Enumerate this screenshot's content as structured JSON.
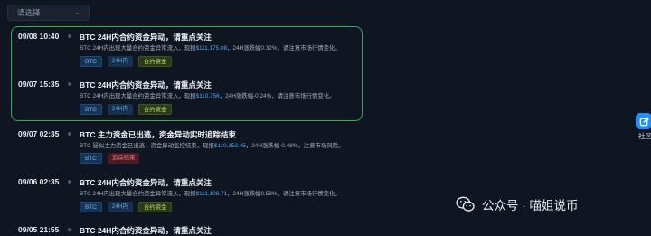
{
  "filter": {
    "placeholder": "请选择"
  },
  "feed": {
    "items": [
      {
        "time": "09/08 10:40",
        "title": "BTC 24H内合约资金异动，请重点关注",
        "desc_pre": "BTC 24H内出现大量合约资金异常流入，现报",
        "price": "$111,175.08",
        "desc_post": "，24H涨跌幅0.32%，请注意市场行情变化。",
        "tags": [
          {
            "label": "BTC",
            "kind": "coin"
          },
          {
            "label": "24H内",
            "kind": "period"
          },
          {
            "label": "合约资金",
            "kind": "contract"
          }
        ]
      },
      {
        "time": "09/07 15:35",
        "title": "BTC 24H内合约资金异动，请重点关注",
        "desc_pre": "BTC 24H内出现大量合约资金异常流入，现报",
        "price": "$110,756",
        "desc_post": "，24H涨跌幅-0.24%，请注意市场行情变化。",
        "tags": [
          {
            "label": "BTC",
            "kind": "coin"
          },
          {
            "label": "24H内",
            "kind": "period"
          },
          {
            "label": "合约资金",
            "kind": "contract"
          }
        ]
      },
      {
        "time": "09/07 02:35",
        "title": "BTC 主力资金已出逃，资金异动实时追踪结束",
        "desc_pre": "BTC 疑似主力资金已出逃，资金异动监控结束，现报",
        "price": "$110,152.45",
        "desc_post": "，24H涨跌幅-0.48%，注意市场风险。",
        "tags": [
          {
            "label": "BTC",
            "kind": "coin"
          },
          {
            "label": "追踪结束",
            "kind": "tracking"
          }
        ]
      },
      {
        "time": "09/06 02:35",
        "title": "BTC 24H内合约资金异动，请重点关注",
        "desc_pre": "BTC 24H内出现大量合约资金异常流入，现报",
        "price": "$111,108.71",
        "desc_post": "，24H涨跌幅0.58%，请注意市场行情变化。",
        "tags": [
          {
            "label": "BTC",
            "kind": "coin"
          },
          {
            "label": "24H内",
            "kind": "period"
          },
          {
            "label": "合约资金",
            "kind": "contract"
          }
        ]
      },
      {
        "time": "09/05 21:55",
        "title": "BTC 24H内合约资金异动，请重点关注",
        "desc_pre": "",
        "price": "",
        "desc_post": "",
        "tags": []
      }
    ]
  },
  "sidebar": {
    "community_label": "社区",
    "icon": "share-icon"
  },
  "watermark": {
    "text": "公众号 · 喵姐说币",
    "icon": "wechat-icon"
  },
  "colors": {
    "highlight": "#2fb04a",
    "price": "#4ea7ff",
    "background": "#0f1621"
  }
}
